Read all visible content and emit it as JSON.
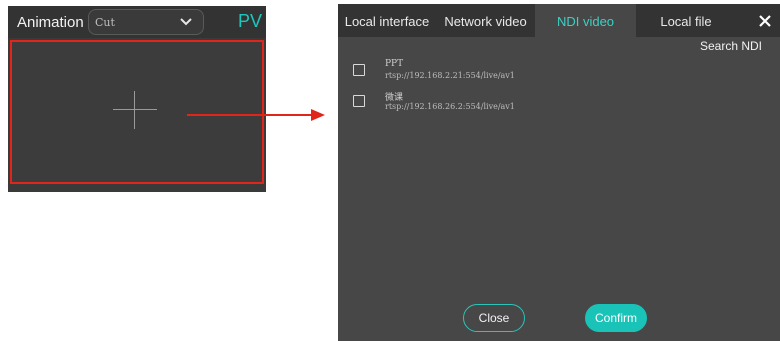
{
  "left_panel": {
    "animation_label": "Animation",
    "animation_select_value": "Cut",
    "pv_label": "PV"
  },
  "dialog": {
    "tabs": [
      {
        "label": "Local interface"
      },
      {
        "label": "Network video"
      },
      {
        "label": "NDI video"
      },
      {
        "label": "Local file"
      }
    ],
    "active_tab": "NDI video",
    "search_ndi_label": "Search NDI",
    "ndi_sources": [
      {
        "name": "PPT",
        "url": "rtsp://192.168.2.21:554/live/av1"
      },
      {
        "name": "微课",
        "url": "rtsp://192.168.26.2:554/live/av1"
      }
    ],
    "close_button": "Close",
    "confirm_button": "Confirm"
  },
  "colors": {
    "accent": "#1ac3b7",
    "highlight_border": "#e0251b",
    "arrow": "#e0251b",
    "dialog_bg": "#474747",
    "tabbar_bg": "#333333"
  },
  "icons": {
    "dropdown": "chevron-down-icon",
    "add": "plus-icon",
    "close": "close-icon",
    "arrow": "arrow-right-icon"
  }
}
